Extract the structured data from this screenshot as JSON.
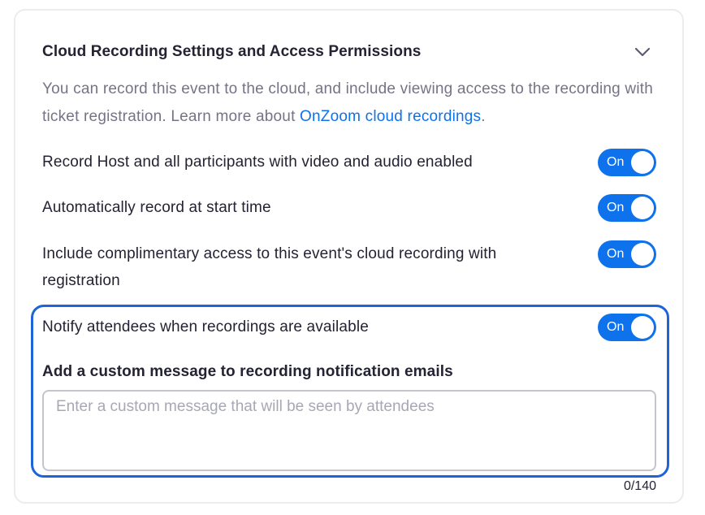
{
  "section": {
    "title": "Cloud Recording Settings and Access Permissions",
    "description_text": "You can record this event to the cloud, and include viewing access to the recording with ticket registration. Learn more about ",
    "description_link": "OnZoom cloud recordings",
    "description_end": "."
  },
  "settings": [
    {
      "label": "Record Host and all participants with video and audio enabled",
      "state": "On"
    },
    {
      "label": "Automatically record at start time",
      "state": "On"
    },
    {
      "label": "Include complimentary access to this event's cloud recording with registration",
      "state": "On"
    },
    {
      "label": "Notify attendees when recordings are available",
      "state": "On"
    }
  ],
  "custom_message": {
    "heading": "Add a custom message to recording notification emails",
    "placeholder": "Enter a custom message that will be seen by attendees",
    "value": "",
    "counter": "0/140"
  },
  "colors": {
    "accent": "#0e72ed",
    "highlight_border": "#1f63d8",
    "muted_text": "#747487"
  },
  "icons": {
    "collapse": "chevron-down-icon"
  }
}
